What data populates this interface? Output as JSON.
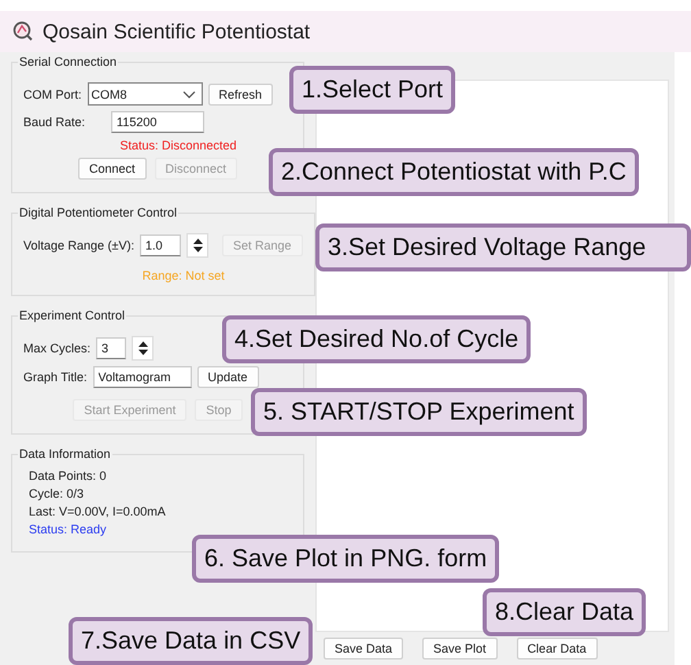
{
  "window": {
    "title": "Qosain Scientific Potentiostat"
  },
  "serial_connection": {
    "title": "Serial Connection",
    "com_port": {
      "label": "COM Port:",
      "value": "COM8"
    },
    "refresh": {
      "label": "Refresh",
      "disabled": false
    },
    "baud_rate": {
      "label": "Baud Rate:",
      "value": "115200"
    },
    "status": {
      "text": "Status: Disconnected",
      "kind": "error"
    },
    "buttons": [
      {
        "label": "Connect",
        "disabled": false
      },
      {
        "label": "Disconnect",
        "disabled": true
      }
    ]
  },
  "potentiometer": {
    "title": "Digital Potentiometer Control",
    "voltage": {
      "label": "Voltage Range (±V):",
      "value": "1.0"
    },
    "set_range": {
      "label": "Set Range",
      "disabled": true
    },
    "status": {
      "text": "Range: Not set",
      "kind": "warning"
    }
  },
  "experiment": {
    "title": "Experiment Control",
    "max_cycles": {
      "label": "Max Cycles:",
      "value": "3"
    },
    "graph_title": {
      "label": "Graph Title:",
      "value": "Voltamogram"
    },
    "update": {
      "label": "Update",
      "disabled": false
    },
    "buttons": [
      {
        "label": "Start Experiment",
        "disabled": true
      },
      {
        "label": "Stop",
        "disabled": true
      }
    ]
  },
  "data_information": {
    "title": "Data Information",
    "lines": [
      {
        "text": "Data Points: 0",
        "kind": "plain"
      },
      {
        "text": "Cycle: 0/3",
        "kind": "plain"
      },
      {
        "text": "Last: V=0.00V, I=0.00mA",
        "kind": "plain"
      },
      {
        "text": "Status: Ready",
        "kind": "info"
      }
    ]
  },
  "plot_buttons": [
    {
      "label": "Save Data",
      "disabled": false
    },
    {
      "label": "Save Plot",
      "disabled": false
    },
    {
      "label": "Clear Data",
      "disabled": false
    }
  ],
  "callouts": [
    {
      "text": "1.Select Port"
    },
    {
      "text": "2.Connect Potentiostat with P.C"
    },
    {
      "text": "3.Set Desired Voltage Range"
    },
    {
      "text": "4.Set Desired No.of Cycle"
    },
    {
      "text": "5. START/STOP Experiment"
    },
    {
      "text": "6. Save Plot in PNG. form"
    },
    {
      "text": "8.Clear Data"
    },
    {
      "text": "7.Save Data in CSV"
    }
  ]
}
